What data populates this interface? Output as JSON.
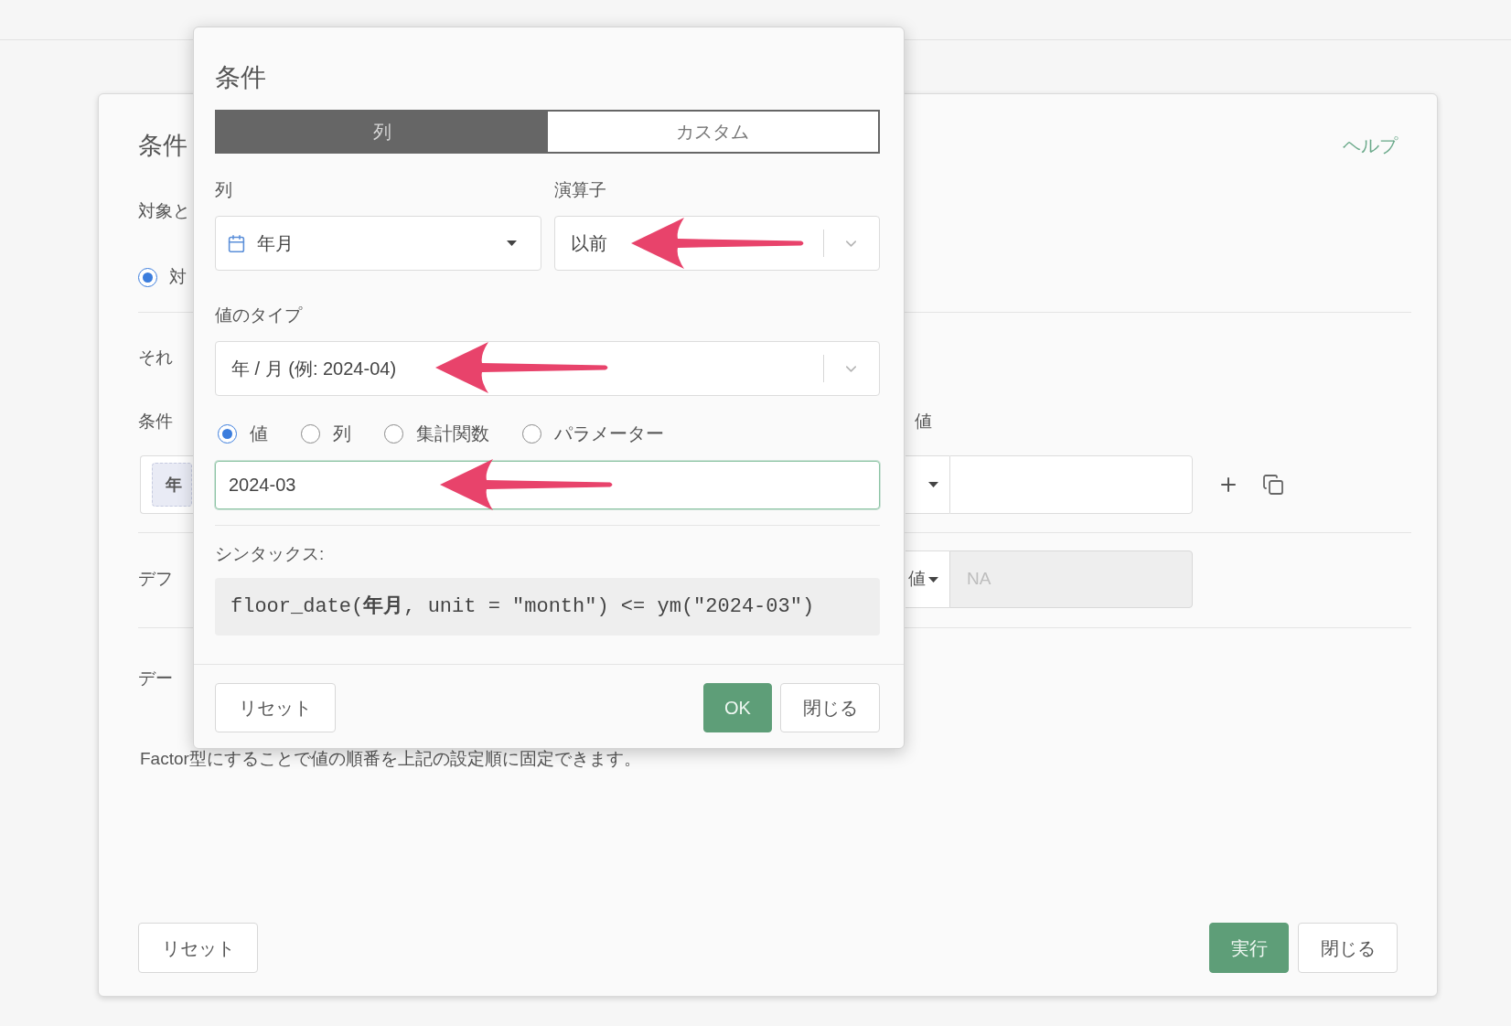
{
  "background_panel": {
    "title": "条件",
    "help_link": "ヘルプ",
    "target_label": "対象と",
    "target_option": {
      "label": "対",
      "selected": true
    },
    "each_label": "それ",
    "condition_label": "条件",
    "condition_chip": "年",
    "value_label": "値",
    "default_label": "デフ",
    "default_select": "値",
    "default_placeholder": "NA",
    "data_label": "デー",
    "note": "Factor型にすることで値の順番を上記の設定順に固定できます。",
    "buttons": [
      {
        "label": "リセット",
        "kind": "secondary"
      },
      {
        "label": "実行",
        "kind": "primary"
      },
      {
        "label": "閉じる",
        "kind": "secondary"
      }
    ]
  },
  "dialog": {
    "title": "条件",
    "tabs": [
      {
        "label": "列",
        "selected": true
      },
      {
        "label": "カスタム",
        "selected": false
      }
    ],
    "column_field": {
      "label": "列",
      "value": "年月"
    },
    "operator_field": {
      "label": "演算子",
      "value": "以前"
    },
    "value_type_field": {
      "label": "値のタイプ",
      "value": "年 / 月 (例: 2024-04)"
    },
    "value_sources": [
      {
        "label": "値",
        "selected": true
      },
      {
        "label": "列",
        "selected": false
      },
      {
        "label": "集計関数",
        "selected": false
      },
      {
        "label": "パラメーター",
        "selected": false
      }
    ],
    "value_input": {
      "value": "2024-03",
      "focused": true
    },
    "syntax": {
      "label": "シンタックス:",
      "code": "floor_date(**年月**, unit = \"month\") <= ym(\"2024-03\")"
    },
    "buttons": [
      {
        "label": "リセット",
        "kind": "secondary"
      },
      {
        "label": "OK",
        "kind": "primary"
      },
      {
        "label": "閉じる",
        "kind": "secondary"
      }
    ]
  }
}
